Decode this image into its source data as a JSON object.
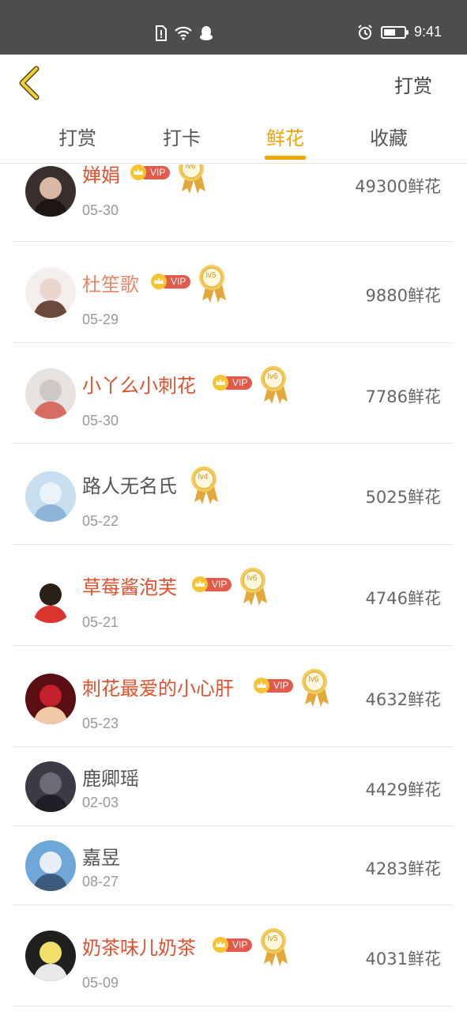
{
  "status_bar": {
    "time": "9:41",
    "battery_level": 0.6
  },
  "header": {
    "back_icon": "chevron-left-icon",
    "action_label": "打赏"
  },
  "tabs": [
    {
      "label": "打赏",
      "active": false
    },
    {
      "label": "打卡",
      "active": false
    },
    {
      "label": "鲜花",
      "active": true
    },
    {
      "label": "收藏",
      "active": false
    }
  ],
  "colors": {
    "accent": "#f0a400",
    "vip_name": "#e0512e",
    "vip_pill": "#e25a4c",
    "status_bar": "#4d4d4d"
  },
  "rows": [
    {
      "name": "婵娟",
      "date": "05-30",
      "score": "49300鲜花",
      "vip": true,
      "vip_label": "VIP",
      "level": "lv6"
    },
    {
      "name": "杜笙歌",
      "date": "05-29",
      "score": "9880鲜花",
      "vip": true,
      "vip_label": "VIP",
      "level": "lv5"
    },
    {
      "name": "小丫么小刺花",
      "date": "05-30",
      "score": "7786鲜花",
      "vip": true,
      "vip_label": "VIP",
      "level": "lv6"
    },
    {
      "name": "路人无名氏",
      "date": "05-22",
      "score": "5025鲜花",
      "vip": false,
      "vip_label": "",
      "level": "lv4"
    },
    {
      "name": "草莓酱泡芙",
      "date": "05-21",
      "score": "4746鲜花",
      "vip": true,
      "vip_label": "VIP",
      "level": "lv6"
    },
    {
      "name": "刺花最爱的小心肝",
      "date": "05-23",
      "score": "4632鲜花",
      "vip": true,
      "vip_label": "VIP",
      "level": "lv6"
    },
    {
      "name": "鹿卿瑶",
      "date": "02-03",
      "score": "4429鲜花",
      "vip": false,
      "vip_label": "",
      "level": ""
    },
    {
      "name": "嘉昱",
      "date": "08-27",
      "score": "4283鲜花",
      "vip": false,
      "vip_label": "",
      "level": ""
    },
    {
      "name": "奶茶味儿奶茶",
      "date": "05-09",
      "score": "4031鲜花",
      "vip": true,
      "vip_label": "VIP",
      "level": "lv5"
    }
  ]
}
